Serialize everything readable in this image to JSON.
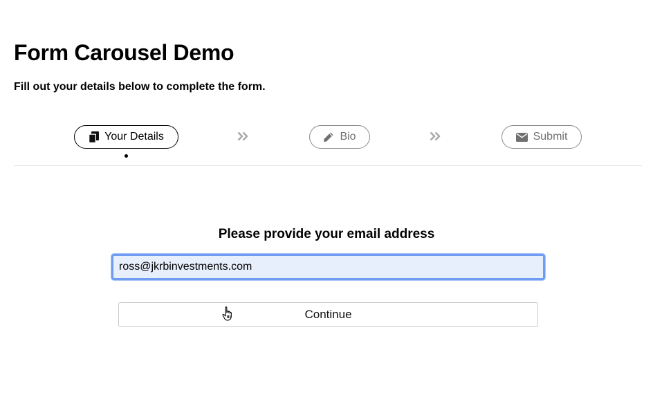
{
  "header": {
    "title": "Form Carousel Demo",
    "subtitle": "Fill out your details below to complete the form."
  },
  "steps": [
    {
      "label": "Your Details",
      "icon": "copy-icon",
      "active": true
    },
    {
      "label": "Bio",
      "icon": "pencil-icon",
      "active": false
    },
    {
      "label": "Submit",
      "icon": "envelope-icon",
      "active": false
    }
  ],
  "form": {
    "prompt": "Please provide your email address",
    "email_value": "ross@jkrbinvestments.com",
    "continue_label": "Continue"
  },
  "colors": {
    "focus_border": "#6f9cf0",
    "input_fill": "#e8effc",
    "inactive_step": "#707070",
    "separator": "#a8a8a8"
  }
}
